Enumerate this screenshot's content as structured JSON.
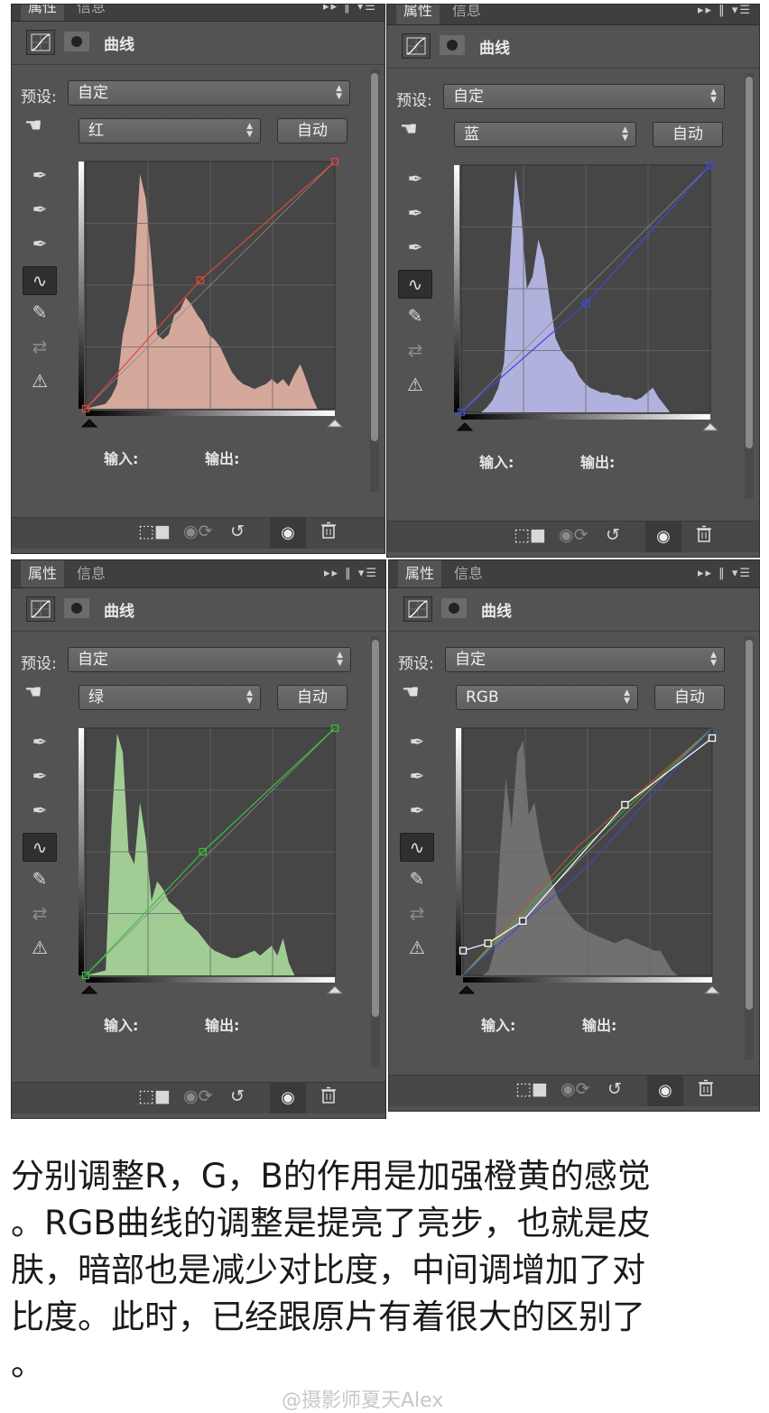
{
  "panels": [
    {
      "tabs": {
        "active": "属性",
        "inactive": "信息"
      },
      "title": "曲线",
      "preset_label": "预设:",
      "preset_value": "自定",
      "channel": "红",
      "auto_label": "自动",
      "input_label": "输入:",
      "output_label": "输出:",
      "colors": {
        "hist": "#dcaea0",
        "curve": "#e0473a"
      },
      "curve_points": [
        [
          0,
          0
        ],
        [
          0.46,
          0.52
        ],
        [
          1,
          1
        ]
      ]
    },
    {
      "tabs": {
        "active": "属性",
        "inactive": "信息"
      },
      "title": "曲线",
      "preset_label": "预设:",
      "preset_value": "自定",
      "channel": "蓝",
      "auto_label": "自动",
      "input_label": "输入:",
      "output_label": "输出:",
      "colors": {
        "hist": "#b6b7e6",
        "curve": "#4047e0"
      },
      "curve_points": [
        [
          0,
          0
        ],
        [
          0.5,
          0.44
        ],
        [
          1,
          1
        ]
      ]
    },
    {
      "tabs": {
        "active": "属性",
        "inactive": "信息"
      },
      "title": "曲线",
      "preset_label": "预设:",
      "preset_value": "自定",
      "channel": "绿",
      "auto_label": "自动",
      "input_label": "输入:",
      "output_label": "输出:",
      "colors": {
        "hist": "#a6d59a",
        "curve": "#36c43a"
      },
      "curve_points": [
        [
          0,
          0
        ],
        [
          0.47,
          0.5
        ],
        [
          1,
          1
        ]
      ]
    },
    {
      "tabs": {
        "active": "属性",
        "inactive": "信息"
      },
      "title": "曲线",
      "preset_label": "预设:",
      "preset_value": "自定",
      "channel": "RGB",
      "auto_label": "自动",
      "input_label": "输入:",
      "output_label": "输出:",
      "colors": {
        "hist": "#737373",
        "curve": "#ffffff"
      },
      "curve_points": [
        [
          0,
          0.1
        ],
        [
          0.1,
          0.13
        ],
        [
          0.24,
          0.22
        ],
        [
          0.65,
          0.69
        ],
        [
          1,
          0.96
        ]
      ]
    }
  ],
  "caption_lines": [
    "分别调整R，G，B的作用是加强橙黄的感觉",
    "。RGB曲线的调整是提亮了亮步，也就是皮",
    "肤，暗部也是减少对比度，中间调增加了对",
    "比度。此时，已经跟原片有着很大的区别了",
    "。"
  ],
  "watermark": "@摄影师夏天Alex"
}
